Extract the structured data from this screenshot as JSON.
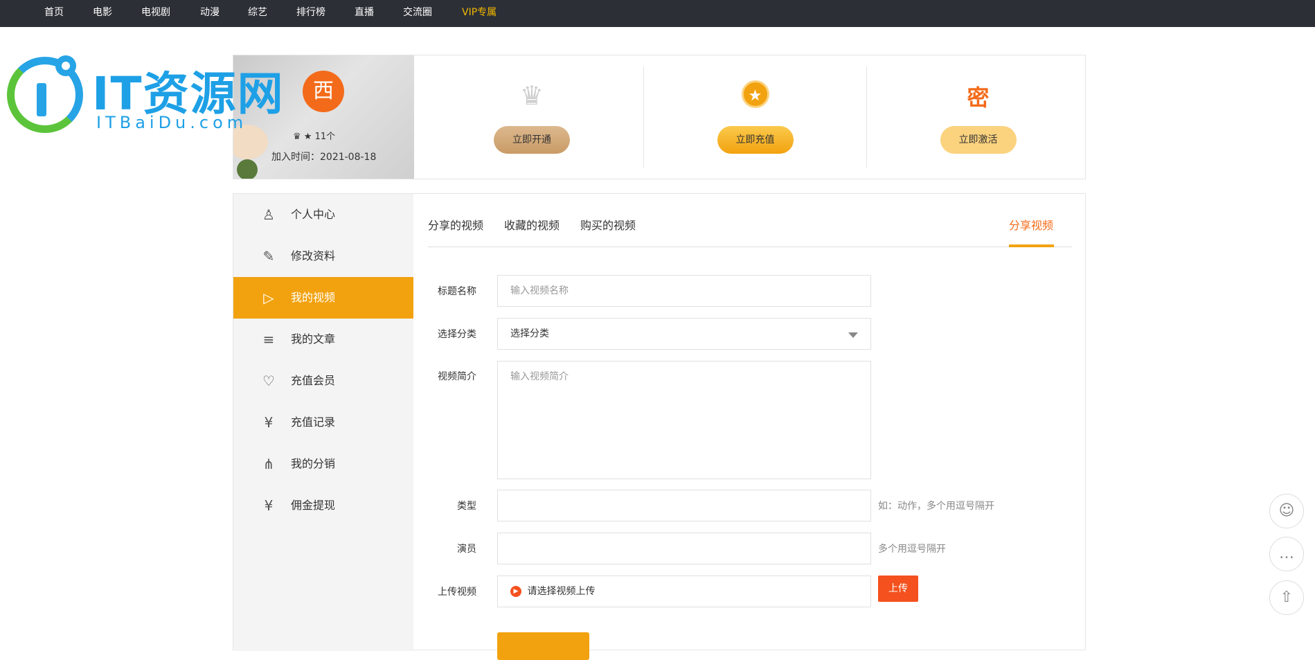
{
  "nav": {
    "items": [
      "首页",
      "电影",
      "电视剧",
      "动漫",
      "综艺",
      "排行榜",
      "直播",
      "交流圈"
    ],
    "vip": "VIP专属"
  },
  "logo": {
    "title": "IT资源网",
    "subtitle": "ITBaiDu.com"
  },
  "profile": {
    "avatar_char": "西",
    "badge": "♛ ★ 11个",
    "joined": "加入时间：2021-08-18",
    "actions": [
      {
        "icon": "crown-icon",
        "glyph": "♛",
        "label": "立即开通",
        "color": "#d2a878"
      },
      {
        "icon": "star-coin-icon",
        "glyph": "★",
        "label": "立即充值",
        "color": "#f4b42a"
      },
      {
        "icon": "key-icon",
        "glyph": "密",
        "label": "立即激活",
        "color": "#fbd27e"
      }
    ]
  },
  "sidebar": {
    "items": [
      {
        "label": "个人中心",
        "icon": "user-icon",
        "glyph": "♙"
      },
      {
        "label": "修改资料",
        "icon": "edit-profile-icon",
        "glyph": "✎"
      },
      {
        "label": "我的视频",
        "icon": "play-circle-icon",
        "glyph": "▷",
        "active": true
      },
      {
        "label": "我的文章",
        "icon": "document-icon",
        "glyph": "≡"
      },
      {
        "label": "充值会员",
        "icon": "heart-location-icon",
        "glyph": "♡"
      },
      {
        "label": "充值记录",
        "icon": "receipt-icon",
        "glyph": "¥"
      },
      {
        "label": "我的分销",
        "icon": "network-icon",
        "glyph": "⋔"
      },
      {
        "label": "佣金提现",
        "icon": "money-bag-icon",
        "glyph": "¥"
      }
    ]
  },
  "tabs": [
    "分享的视频",
    "收藏的视频",
    "购买的视频"
  ],
  "share_tab": "分享视频",
  "form": {
    "title_label": "标题名称",
    "title_placeholder": "输入视频名称",
    "category_label": "选择分类",
    "category_value": "选择分类",
    "intro_label": "视频简介",
    "intro_placeholder": "输入视频简介",
    "type_label": "类型",
    "type_hint": "如：动作，多个用逗号隔开",
    "actor_label": "演员",
    "actor_hint": "多个用逗号隔开",
    "upload_label": "上传视频",
    "upload_text": "请选择视频上传",
    "upload_button": "上传"
  },
  "float_buttons": [
    "qq-icon",
    "chat-icon",
    "back-to-top-icon"
  ],
  "colors": {
    "accent": "#f2a20f",
    "orange": "#f36b1a",
    "upload_red": "#f4511e",
    "topnav": "#2c2f36"
  }
}
